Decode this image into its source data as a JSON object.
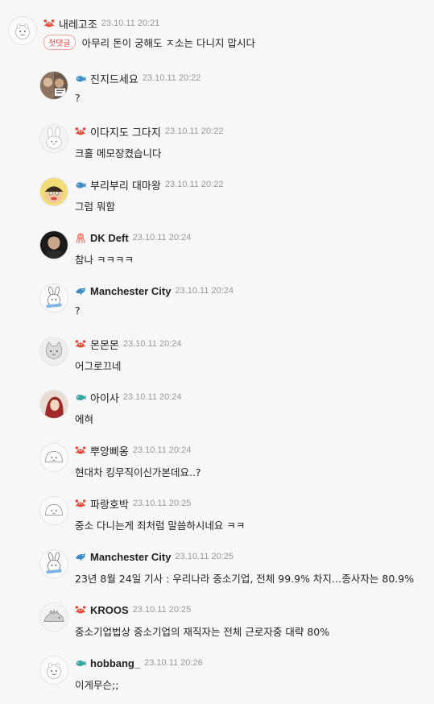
{
  "colors": {
    "background": "#f7f7f7",
    "crab_badge": "#e34b3b",
    "fish_blue": "#3f8dc6",
    "fish_teal": "#34a7a0",
    "octopus": "#f08a7a"
  },
  "top_comment": {
    "author": "내레고조",
    "badge_icon": "crab-icon",
    "time": "23.10.11 20:21",
    "first_comment_tag": "첫댓글",
    "text": "아무리 돈이 궁해도 ㅈ소는 다니지 맙시다"
  },
  "replies": [
    {
      "author": "진지드세요",
      "badge_icon": "blue-fish-icon",
      "time": "23.10.11 20:22",
      "text": "?"
    },
    {
      "author": "이다지도 그다지",
      "badge_icon": "crab-icon",
      "time": "23.10.11 20:22",
      "text": "크흘 메모장켰습니다"
    },
    {
      "author": "부리부리 대마왕",
      "badge_icon": "blue-fish-icon",
      "time": "23.10.11 20:22",
      "text": "그럼 뭐함"
    },
    {
      "author": "DK Deft",
      "badge_icon": "octopus-icon",
      "time": "23.10.11 20:24",
      "text": "참나 ㅋㅋㅋㅋ"
    },
    {
      "author": "Manchester City",
      "badge_icon": "dolphin-icon",
      "time": "23.10.11 20:24",
      "text": "?"
    },
    {
      "author": "몬몬몬",
      "badge_icon": "crab-icon",
      "time": "23.10.11 20:24",
      "text": "어그로끄네"
    },
    {
      "author": "아이사",
      "badge_icon": "teal-fish-icon",
      "time": "23.10.11 20:24",
      "text": "에혀"
    },
    {
      "author": "뿌앙삐옹",
      "badge_icon": "crab-icon",
      "time": "23.10.11 20:24",
      "text": "현대차 킹무직이신가본데요..?"
    },
    {
      "author": "파랑호박",
      "badge_icon": "crab-icon",
      "time": "23.10.11 20:25",
      "text": "중소 다니는게 죄처럼 말씀하시네요 ㅋㅋ"
    },
    {
      "author": "Manchester City",
      "badge_icon": "dolphin-icon",
      "time": "23.10.11 20:25",
      "text": "23년 8월 24일 기사 : 우리나라 중소기업, 전체 99.9% 차지…종사자는 80.9%"
    },
    {
      "author": "KROOS",
      "badge_icon": "crab-icon",
      "time": "23.10.11 20:25",
      "text": "중소기업법상 중소기업의 재직자는 전체 근로자중 대략 80%"
    },
    {
      "author": "hobbang_",
      "badge_icon": "teal-fish-icon",
      "time": "23.10.11 20:26",
      "text": "이게무슨;;"
    }
  ]
}
